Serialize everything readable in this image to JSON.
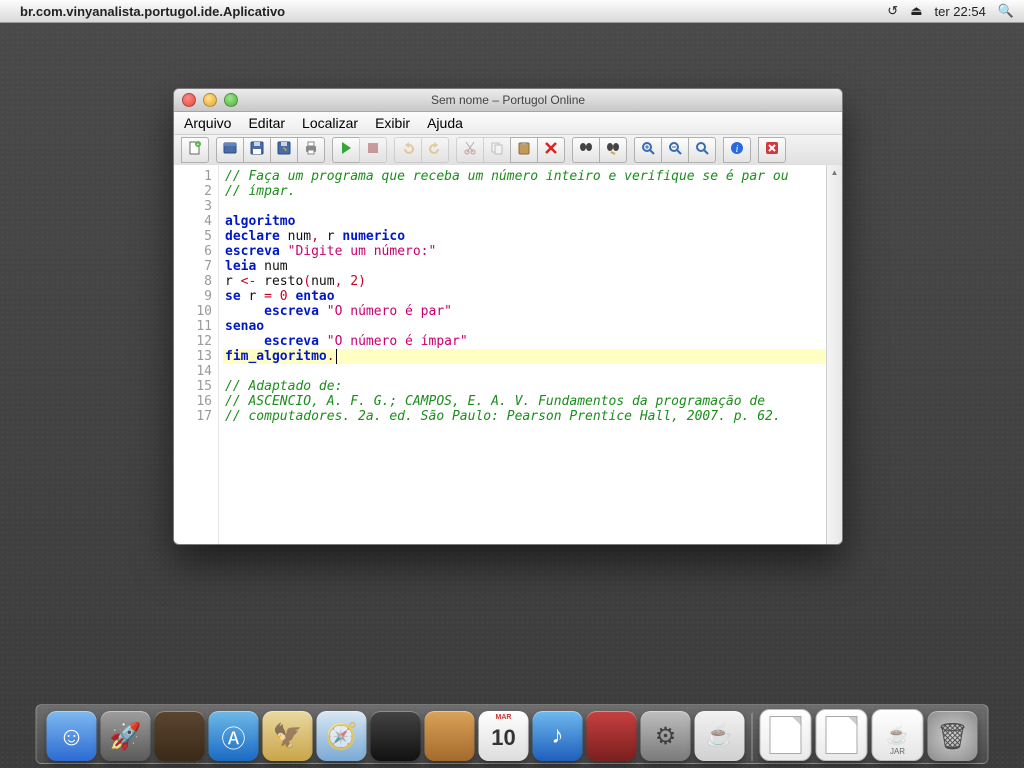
{
  "menubar": {
    "app_name": "br.com.vinyanalista.portugol.ide.Aplicativo",
    "clock": "ter 22:54"
  },
  "window": {
    "title": "Sem nome – Portugol Online",
    "menu": {
      "file": "Arquivo",
      "edit": "Editar",
      "find": "Localizar",
      "view": "Exibir",
      "help": "Ajuda"
    }
  },
  "code": {
    "lines": [
      {
        "n": "1",
        "seg": [
          {
            "c": "cmt",
            "t": "// Faça um programa que receba um número inteiro e verifique se é par ou"
          }
        ]
      },
      {
        "n": "2",
        "seg": [
          {
            "c": "cmt",
            "t": "// ímpar."
          }
        ]
      },
      {
        "n": "3",
        "seg": []
      },
      {
        "n": "4",
        "seg": [
          {
            "c": "kw",
            "t": "algoritmo"
          }
        ]
      },
      {
        "n": "5",
        "seg": [
          {
            "c": "kw",
            "t": "declare"
          },
          {
            "c": "id",
            "t": " num"
          },
          {
            "c": "op",
            "t": ","
          },
          {
            "c": "id",
            "t": " r "
          },
          {
            "c": "kw",
            "t": "numerico"
          }
        ]
      },
      {
        "n": "6",
        "seg": [
          {
            "c": "kw",
            "t": "escreva"
          },
          {
            "c": "id",
            "t": " "
          },
          {
            "c": "str",
            "t": "\"Digite um número:\""
          }
        ]
      },
      {
        "n": "7",
        "seg": [
          {
            "c": "kw",
            "t": "leia"
          },
          {
            "c": "id",
            "t": " num"
          }
        ]
      },
      {
        "n": "8",
        "seg": [
          {
            "c": "id",
            "t": "r "
          },
          {
            "c": "op",
            "t": "<-"
          },
          {
            "c": "id",
            "t": " resto"
          },
          {
            "c": "op",
            "t": "("
          },
          {
            "c": "id",
            "t": "num"
          },
          {
            "c": "op",
            "t": ","
          },
          {
            "c": "id",
            "t": " "
          },
          {
            "c": "num",
            "t": "2"
          },
          {
            "c": "op",
            "t": ")"
          }
        ]
      },
      {
        "n": "9",
        "seg": [
          {
            "c": "kw",
            "t": "se"
          },
          {
            "c": "id",
            "t": " r "
          },
          {
            "c": "op",
            "t": "="
          },
          {
            "c": "id",
            "t": " "
          },
          {
            "c": "num",
            "t": "0"
          },
          {
            "c": "id",
            "t": " "
          },
          {
            "c": "kw",
            "t": "entao"
          }
        ]
      },
      {
        "n": "10",
        "seg": [
          {
            "c": "id",
            "t": "     "
          },
          {
            "c": "kw",
            "t": "escreva"
          },
          {
            "c": "id",
            "t": " "
          },
          {
            "c": "str",
            "t": "\"O número é par\""
          }
        ]
      },
      {
        "n": "11",
        "seg": [
          {
            "c": "kw",
            "t": "senao"
          }
        ]
      },
      {
        "n": "12",
        "seg": [
          {
            "c": "id",
            "t": "     "
          },
          {
            "c": "kw",
            "t": "escreva"
          },
          {
            "c": "id",
            "t": " "
          },
          {
            "c": "str",
            "t": "\"O número é ímpar\""
          }
        ]
      },
      {
        "n": "13",
        "seg": [
          {
            "c": "kw",
            "t": "fim_algoritmo"
          },
          {
            "c": "op",
            "t": "."
          }
        ],
        "hl": true,
        "cursor": true
      },
      {
        "n": "14",
        "seg": []
      },
      {
        "n": "15",
        "seg": [
          {
            "c": "cmt",
            "t": "// Adaptado de:"
          }
        ]
      },
      {
        "n": "16",
        "seg": [
          {
            "c": "cmt",
            "t": "// ASCENCIO, A. F. G.; CAMPOS, E. A. V. Fundamentos da programação de"
          }
        ]
      },
      {
        "n": "17",
        "seg": [
          {
            "c": "cmt",
            "t": "// computadores. 2a. ed. São Paulo: Pearson Prentice Hall, 2007. p. 62."
          }
        ]
      }
    ]
  },
  "toolbar_icons": [
    {
      "grp": [
        {
          "name": "new-file-icon"
        }
      ]
    },
    {
      "grp": [
        {
          "name": "open-icon"
        },
        {
          "name": "save-icon"
        },
        {
          "name": "save-as-icon"
        },
        {
          "name": "print-icon"
        }
      ]
    },
    {
      "grp": [
        {
          "name": "run-icon"
        },
        {
          "name": "stop-icon",
          "dis": true
        }
      ]
    },
    {
      "grp": [
        {
          "name": "undo-icon",
          "dis": true
        },
        {
          "name": "redo-icon",
          "dis": true
        }
      ]
    },
    {
      "grp": [
        {
          "name": "cut-icon",
          "dis": true
        },
        {
          "name": "copy-icon",
          "dis": true
        },
        {
          "name": "paste-icon"
        },
        {
          "name": "delete-icon"
        }
      ]
    },
    {
      "grp": [
        {
          "name": "find-icon"
        },
        {
          "name": "replace-icon"
        }
      ]
    },
    {
      "grp": [
        {
          "name": "zoom-in-icon"
        },
        {
          "name": "zoom-out-icon"
        },
        {
          "name": "zoom-reset-icon"
        }
      ]
    },
    {
      "grp": [
        {
          "name": "info-icon"
        }
      ]
    },
    {
      "grp": [
        {
          "name": "exit-icon"
        }
      ]
    }
  ],
  "dock": {
    "items": [
      {
        "name": "finder",
        "c1": "#7fb9ef",
        "c2": "#2b6bd3"
      },
      {
        "name": "launchpad",
        "c1": "#9e9e9e",
        "c2": "#5a5a5a"
      },
      {
        "name": "mission-control",
        "c1": "#5b4530",
        "c2": "#3a2a18"
      },
      {
        "name": "app-store",
        "c1": "#6fb9e7",
        "c2": "#1a6ac4"
      },
      {
        "name": "mail",
        "c1": "#e9d9a0",
        "c2": "#c9a54a"
      },
      {
        "name": "safari",
        "c1": "#d8e7f4",
        "c2": "#7aa9d4"
      },
      {
        "name": "facetime",
        "c1": "#444",
        "c2": "#111"
      },
      {
        "name": "contacts",
        "c1": "#dba25a",
        "c2": "#a36a2c"
      },
      {
        "name": "calendar",
        "c1": "#fff",
        "c2": "#ddd"
      },
      {
        "name": "itunes",
        "c1": "#6fb9ef",
        "c2": "#1f5fbc"
      },
      {
        "name": "portugol",
        "c1": "#c84040",
        "c2": "#7a1f1f"
      },
      {
        "name": "preferences",
        "c1": "#bfbfbf",
        "c2": "#7a7a7a"
      },
      {
        "name": "java",
        "c1": "#f2f2f2",
        "c2": "#d0d0d0"
      }
    ],
    "right": [
      {
        "name": "doc1"
      },
      {
        "name": "doc2"
      },
      {
        "name": "jar"
      },
      {
        "name": "trash"
      }
    ],
    "calendar_day": "10",
    "calendar_month": "MAR",
    "jar_label": "JAR"
  }
}
